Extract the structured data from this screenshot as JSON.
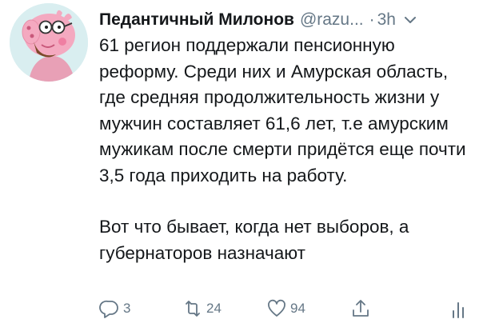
{
  "tweet": {
    "display_name": "Педантичный Милонов",
    "handle": "@razu...",
    "separator": "·",
    "time": "3h",
    "text_paragraph_1": "61 регион поддержали пенсионную реформу. Среди них и Амурская область, где средняя продолжительность жизни у мужчин составляет 61,6 лет, т.е амурским мужикам после смерти придётся еще почти 3,5 года приходить на работу.",
    "text_paragraph_2": "Вот что бывает, когда нет выборов, а губернаторов назначают"
  },
  "actions": {
    "reply_count": "3",
    "retweet_count": "24",
    "like_count": "94"
  },
  "icons": {
    "avatar": "peppa-pig-father-avatar",
    "caret": "chevron-down-icon",
    "reply": "reply-icon",
    "retweet": "retweet-icon",
    "like": "heart-icon",
    "share": "share-icon",
    "analytics": "analytics-icon"
  },
  "colors": {
    "text": "#14171a",
    "secondary": "#657786",
    "background": "#ffffff",
    "avatar_background": "#d9eef0"
  }
}
